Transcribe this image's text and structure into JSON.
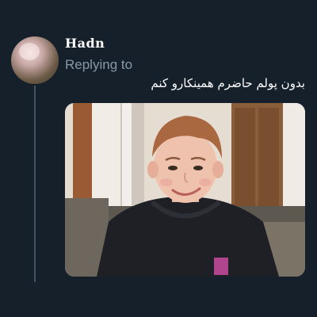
{
  "tweet": {
    "author_name": "Hadn",
    "reply_label": "Replying to",
    "text": "بدون پولم حاضرم همینکارو کنم",
    "media_alt": "boy smiling"
  },
  "colors": {
    "background": "#15202b",
    "secondary_text": "#8899a6",
    "primary_text": "#ffffff",
    "thread_line": "#425364"
  }
}
